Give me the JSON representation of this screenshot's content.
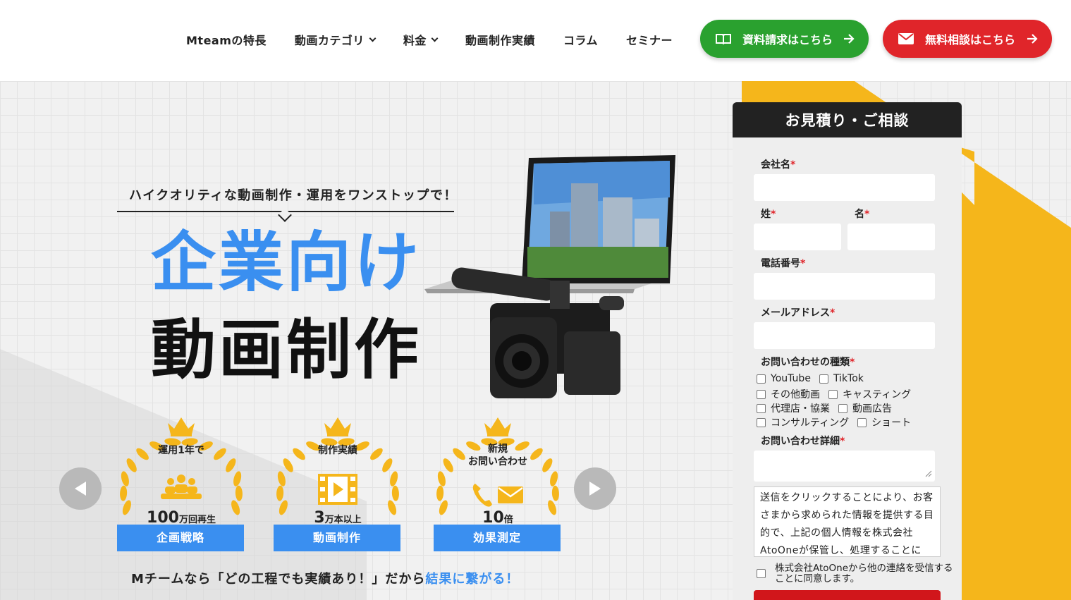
{
  "nav": {
    "items": [
      {
        "label": "Mteamの特長",
        "dropdown": false
      },
      {
        "label": "動画カテゴリ",
        "dropdown": true
      },
      {
        "label": "料金",
        "dropdown": true
      },
      {
        "label": "動画制作実績",
        "dropdown": false
      },
      {
        "label": "コラム",
        "dropdown": false
      },
      {
        "label": "セミナー",
        "dropdown": false
      }
    ],
    "cta_document": "資料請求はこちら",
    "cta_consult": "無料相談はこちら"
  },
  "hero": {
    "tagline": "ハイクオリティな動画制作・運用をワンストップで！",
    "headline_line1": "企業向け",
    "headline_line2": "動画制作",
    "badges": [
      {
        "top": "運用1年で",
        "number": "100",
        "unit": "万回再生",
        "label": "企画戦略",
        "icon": "people-icon"
      },
      {
        "top": "制作実績",
        "number": "3",
        "unit": "万本以上",
        "label": "動画制作",
        "icon": "film-icon"
      },
      {
        "top": "新規\nお問い合わせ",
        "number": "10",
        "unit": "倍",
        "label": "効果測定",
        "icon": "phone-mail-icon"
      }
    ],
    "bottom_text_main": "Mチームなら「どの工程でも実績あり！」だから",
    "bottom_text_highlight": "結果に繋がる！"
  },
  "form": {
    "title": "お見積り・ご相談",
    "company_label": "会社名",
    "last_name_label": "姓",
    "first_name_label": "名",
    "phone_label": "電話番号",
    "email_label": "メールアドレス",
    "inquiry_type_label": "お問い合わせの種類",
    "inquiry_types": [
      [
        "YouTube",
        "TikTok"
      ],
      [
        "その他動画",
        "キャスティング"
      ],
      [
        "代理店・協業",
        "動画広告"
      ],
      [
        "コンサルティング",
        "ショート"
      ]
    ],
    "detail_label": "お問い合わせ詳細",
    "required_mark": "*",
    "terms_text": "送信をクリックすることにより、お客さまから求められた情報を提供する目的で、上記の個人情報を株式会社AtoOneが保管し、処理することに",
    "agree_text": "株式会社AtoOneから他の連絡を受信することに同意します。"
  },
  "colors": {
    "accent_blue": "#3a8ff0",
    "green": "#2aa12f",
    "red": "#e0252a",
    "yellow": "#f5b61b"
  }
}
